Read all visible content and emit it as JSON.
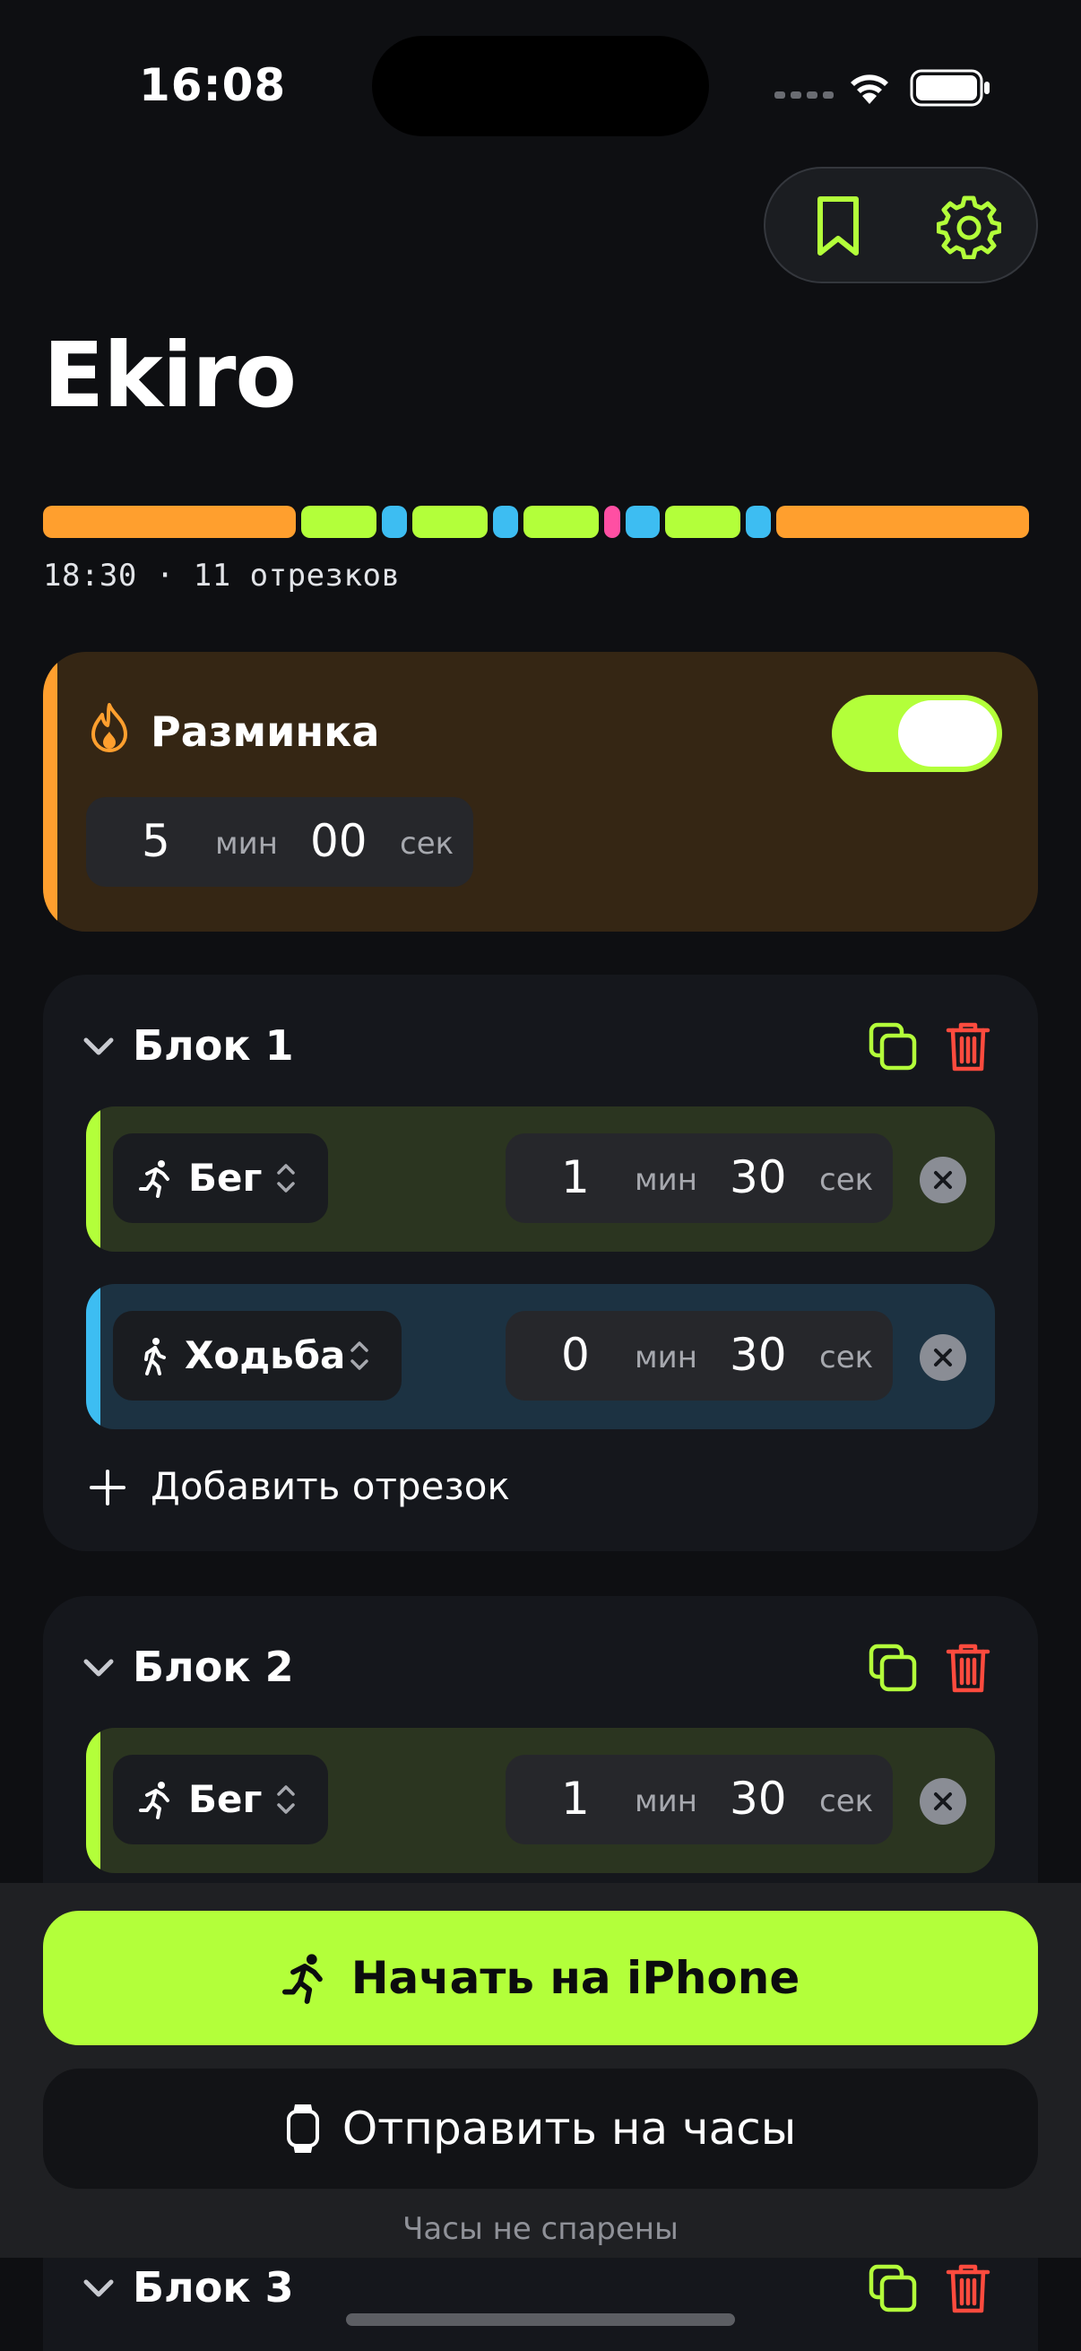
{
  "status_bar": {
    "time": "16:08"
  },
  "app": {
    "title": "Ekiro"
  },
  "nav": {
    "bookmark_icon": "bookmark-icon",
    "settings_icon": "gear-icon"
  },
  "colors": {
    "accent": "#b3ff3a",
    "warmup": "#ff9f2e",
    "run": "#b3ff3a",
    "walk": "#3dbdf2",
    "rest": "#ff4fa3",
    "danger": "#ff4b3e"
  },
  "summary": {
    "text": "18:30 · 11 отрезков"
  },
  "warmup": {
    "title": "Разминка",
    "enabled": true,
    "minutes": "5",
    "seconds": "00",
    "min_unit": "мин",
    "sec_unit": "сек"
  },
  "blocks": [
    {
      "title": "Блок 1",
      "intervals": [
        {
          "activity": "Бег",
          "minutes": "1",
          "seconds": "30",
          "min_unit": "мин",
          "sec_unit": "сек"
        },
        {
          "activity": "Ходьба",
          "minutes": "0",
          "seconds": "30",
          "min_unit": "мин",
          "sec_unit": "сек"
        }
      ],
      "add_label": "Добавить отрезок"
    },
    {
      "title": "Блок 2",
      "intervals": [
        {
          "activity": "Бег",
          "minutes": "1",
          "seconds": "30",
          "min_unit": "мин",
          "sec_unit": "сек"
        }
      ]
    },
    {
      "title": "Блок 3"
    }
  ],
  "actions": {
    "start_label": "Начать на iPhone",
    "send_label": "Отправить на часы",
    "pair_status": "Часы не спарены"
  }
}
